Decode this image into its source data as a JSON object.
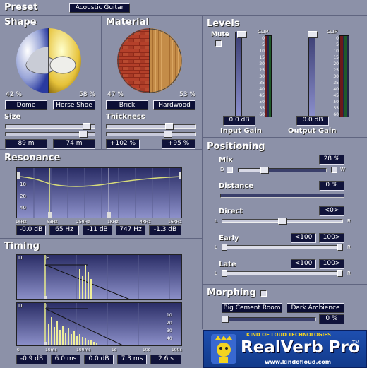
{
  "preset": {
    "title": "Preset",
    "value": "Acoustic Guitar"
  },
  "shape": {
    "title": "Shape",
    "pct_left": "42 %",
    "pct_right": "58 %",
    "btn_left": "Dome",
    "btn_right": "Horse Shoe",
    "size_label": "Size",
    "size_left": "89 m",
    "size_right": "74 m"
  },
  "material": {
    "title": "Material",
    "pct_left": "47 %",
    "pct_right": "53 %",
    "btn_left": "Brick",
    "btn_right": "Hardwood",
    "thick_label": "Thickness",
    "thick_left": "+102 %",
    "thick_right": "+95 %"
  },
  "levels": {
    "title": "Levels",
    "mute": "Mute",
    "clip1": "CLIP",
    "clip2": "CLIP",
    "input_val": "0.0 dB",
    "output_val": "0.0 dB",
    "input_label": "Input Gain",
    "output_label": "Output Gain",
    "scale": [
      "0",
      "5",
      "10",
      "15",
      "20",
      "25",
      "30",
      "35",
      "40",
      "45",
      "50",
      "55",
      "60"
    ]
  },
  "resonance": {
    "title": "Resonance",
    "yticks": [
      "10",
      "20",
      "40"
    ],
    "xticks": [
      "16Hz",
      "63Hz",
      "250Hz",
      "1KHz",
      "4KHz",
      "16KHz"
    ],
    "vals": [
      "-0.0 dB",
      "65 Hz",
      "-11 dB",
      "747 Hz",
      "-1.3 dB"
    ]
  },
  "positioning": {
    "title": "Positioning",
    "mix_label": "Mix",
    "mix_val": "28 %",
    "mix_d": "D",
    "mix_w": "W",
    "dist_label": "Distance",
    "dist_val": "0 %",
    "direct_label": "Direct",
    "direct_val": "<0>",
    "early_label": "Early",
    "early_l": "<100",
    "early_r": "100>",
    "late_label": "Late",
    "late_l": "<100",
    "late_r": "100>",
    "l": "L",
    "r": "R"
  },
  "timing": {
    "title": "Timing",
    "top_d": "D",
    "top_e": "E",
    "bot_d": "D",
    "bot_l": "L",
    "yticks": [
      "10",
      "20",
      "30",
      "40"
    ],
    "xticks": [
      "0",
      "10ms",
      "100ms",
      "1s",
      "10s",
      "100s"
    ],
    "vals": [
      "-0.9 dB",
      "6.0 ms",
      "0.0 dB",
      "7.3 ms",
      "2.6 s"
    ]
  },
  "morphing": {
    "title": "Morphing",
    "btn_left": "Big Cement Room",
    "btn_right": "Dark Ambience",
    "val": "0 %"
  },
  "logo": {
    "company": "KIND OF LOUD TECHNOLOGIES",
    "product": "RealVerb Pro",
    "tm": "TM",
    "url": "www.kindofloud.com"
  }
}
